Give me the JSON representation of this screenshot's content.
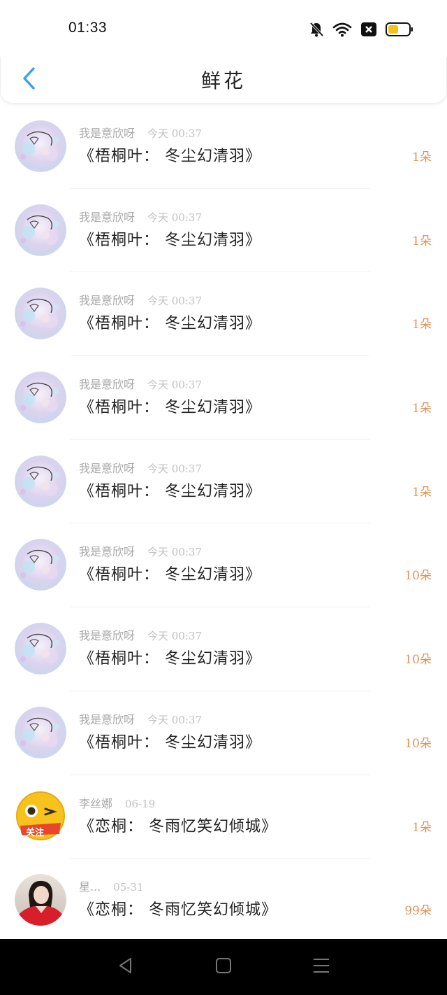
{
  "status": {
    "time": "01:33"
  },
  "header": {
    "title": "鲜花"
  },
  "colors": {
    "accent": "#3aa0e8",
    "count": "#e0925a"
  },
  "rows": [
    {
      "user": "我是意欣呀",
      "time": "今天 00:37",
      "book": "《梧桐叶： 冬尘幻清羽》",
      "count": "1朵",
      "avatar": "anime-girl-avatar"
    },
    {
      "user": "我是意欣呀",
      "time": "今天 00:37",
      "book": "《梧桐叶： 冬尘幻清羽》",
      "count": "1朵",
      "avatar": "anime-girl-avatar"
    },
    {
      "user": "我是意欣呀",
      "time": "今天 00:37",
      "book": "《梧桐叶： 冬尘幻清羽》",
      "count": "1朵",
      "avatar": "anime-girl-avatar"
    },
    {
      "user": "我是意欣呀",
      "time": "今天 00:37",
      "book": "《梧桐叶： 冬尘幻清羽》",
      "count": "1朵",
      "avatar": "anime-girl-avatar"
    },
    {
      "user": "我是意欣呀",
      "time": "今天 00:37",
      "book": "《梧桐叶： 冬尘幻清羽》",
      "count": "1朵",
      "avatar": "anime-girl-avatar"
    },
    {
      "user": "我是意欣呀",
      "time": "今天 00:37",
      "book": "《梧桐叶： 冬尘幻清羽》",
      "count": "10朵",
      "avatar": "anime-girl-avatar"
    },
    {
      "user": "我是意欣呀",
      "time": "今天 00:37",
      "book": "《梧桐叶： 冬尘幻清羽》",
      "count": "10朵",
      "avatar": "anime-girl-avatar"
    },
    {
      "user": "我是意欣呀",
      "time": "今天 00:37",
      "book": "《梧桐叶： 冬尘幻清羽》",
      "count": "10朵",
      "avatar": "anime-girl-avatar"
    },
    {
      "user": "李丝娜",
      "time": "06-19",
      "book": "《恋桐： 冬雨忆笑幻倾城》",
      "count": "1朵",
      "avatar": "emoji-follow-avatar",
      "avatar_text": "关注"
    },
    {
      "user": "星...",
      "time": "05-31",
      "book": "《恋桐： 冬雨忆笑幻倾城》",
      "count": "99朵",
      "avatar": "portrait-avatar"
    }
  ]
}
